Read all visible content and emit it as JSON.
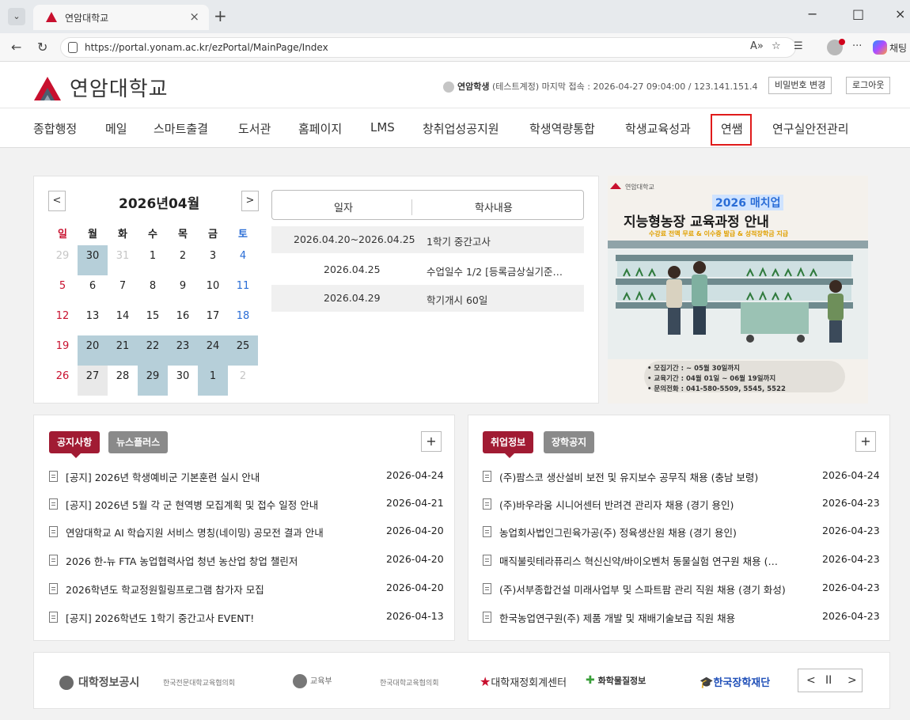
{
  "browser": {
    "tab_title": "연암대학교",
    "tab_close": "×",
    "new_tab": "+",
    "url": "https://portal.yonam.ac.kr/ezPortal/MainPage/Index",
    "chat_label": "채팅",
    "window_controls": [
      "−",
      "□",
      "×"
    ],
    "icons": [
      "back-icon",
      "refresh-icon",
      "lock-icon",
      "read-aloud-icon",
      "favorite-icon",
      "collections-icon",
      "profile-icon",
      "more-icon",
      "copilot-icon"
    ]
  },
  "header": {
    "logo_text": "연암대학교",
    "user_name": "연암학생",
    "user_detail": "(테스트계정) 마지막 접속 : 2026-04-27 09:04:00 / 123.141.151.4",
    "change_password": "비밀번호 변경",
    "logout": "로그아웃",
    "brand_color": "#c8102e"
  },
  "gnb": [
    "종합행정",
    "메일",
    "스마트출결",
    "도서관",
    "홈페이지",
    "LMS",
    "창취업성공지원",
    "학생역량통합",
    "학생교육성과",
    "연쌤",
    "연구실안전관리"
  ],
  "calendar": {
    "title": "2026년04월",
    "prev": "<",
    "next": ">",
    "weekdays": [
      "일",
      "월",
      "화",
      "수",
      "목",
      "금",
      "토"
    ],
    "weeks": [
      [
        "29",
        "30",
        "31",
        "1",
        "2",
        "3",
        "4"
      ],
      [
        "5",
        "6",
        "7",
        "8",
        "9",
        "10",
        "11"
      ],
      [
        "12",
        "13",
        "14",
        "15",
        "16",
        "17",
        "18"
      ],
      [
        "19",
        "20",
        "21",
        "22",
        "23",
        "24",
        "25"
      ],
      [
        "26",
        "27",
        "28",
        "29",
        "30",
        "1",
        "2"
      ]
    ]
  },
  "schedule": {
    "col_date": "일자",
    "col_content": "학사내용",
    "rows": [
      {
        "date": "2026.04.20~2026.04.25",
        "content": "1학기 중간고사"
      },
      {
        "date": "2026.04.25",
        "content": "수업일수 1/2 [등록금상실기준…"
      },
      {
        "date": "2026.04.29",
        "content": "학기개시 60일"
      }
    ]
  },
  "banner": {
    "school": "연암대학교",
    "headline_small": "2026 매치업",
    "headline_big": "지능형농장 교육과정 안내",
    "subline": "수강료 전액 무료 & 이수증 발급 & 성적장학금 지급",
    "details": [
      "• 모집기간 : ~ 05월 30일까지",
      "• 교육기간 : 04월 01일 ~ 06월 19일까지",
      "• 문의전화 : 041-580-5509, 5545, 5522"
    ]
  },
  "notice_board": {
    "tab_active": "공지사항",
    "tab_inactive": "뉴스플러스",
    "more": "+",
    "items": [
      {
        "title": "[공지] 2026년 학생예비군 기본훈련 실시 안내",
        "date": "2026-04-24"
      },
      {
        "title": "[공지] 2026년 5월 각 군 현역병 모집계획 및 접수 일정 안내",
        "date": "2026-04-21"
      },
      {
        "title": "연암대학교 AI 학습지원 서비스 명칭(네이밍) 공모전 결과 안내",
        "date": "2026-04-20"
      },
      {
        "title": "2026 한-뉴 FTA 농업협력사업 청년 농산업 창업 챌린저",
        "date": "2026-04-20"
      },
      {
        "title": "2026학년도 학교정원힐링프로그램 참가자 모집",
        "date": "2026-04-20"
      },
      {
        "title": "[공지] 2026학년도 1학기 중간고사 EVENT!",
        "date": "2026-04-13"
      }
    ]
  },
  "job_board": {
    "tab_active": "취업정보",
    "tab_inactive": "장학공지",
    "more": "+",
    "items": [
      {
        "title": "(주)팜스코 생산설비 보전 및 유지보수 공무직 채용 (충남 보령)",
        "date": "2026-04-24"
      },
      {
        "title": "(주)바우라움 시니어센터 반려견 관리자 채용 (경기 용인)",
        "date": "2026-04-23"
      },
      {
        "title": "농업회사법인그린육가공(주) 정육생산원 채용 (경기 용인)",
        "date": "2026-04-23"
      },
      {
        "title": "매직불릿테라퓨리스 혁신신약/바이오벤처 동물실험 연구원 채용 (…",
        "date": "2026-04-23"
      },
      {
        "title": "(주)서부종합건설 미래사업부 및 스파트팜 관리 직원 채용 (경기 화성)",
        "date": "2026-04-23"
      },
      {
        "title": "한국농업연구원(주) 제품 개발 및 재배기술보급 직원 채용",
        "date": "2026-04-23"
      }
    ]
  },
  "footer": {
    "logos": [
      "대학정보공시",
      "한국전문대학교육협의회",
      "교육부",
      "한국대학교육협의회",
      "대학재정회계센터",
      "화학물질정보",
      "한국장학재단"
    ],
    "prev": "<",
    "pause": "II",
    "next": ">"
  }
}
